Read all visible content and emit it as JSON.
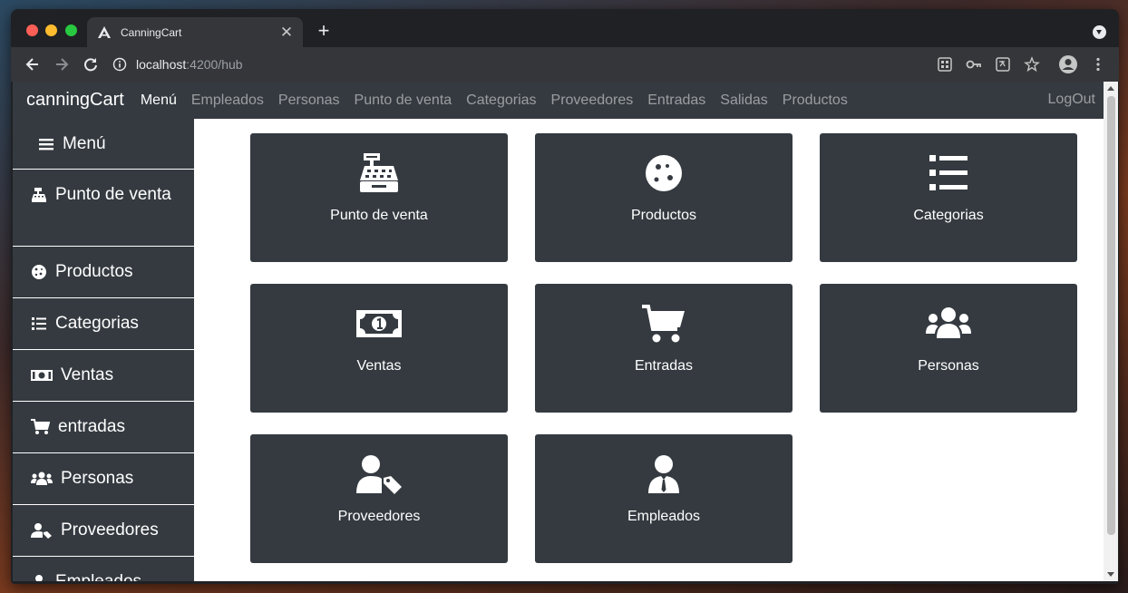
{
  "browser": {
    "tab_title": "CanningCart",
    "url_host": "localhost",
    "url_path": ":4200/hub"
  },
  "navbar": {
    "brand": "canningCart",
    "links": [
      "Menú",
      "Empleados",
      "Personas",
      "Punto de venta",
      "Categorias",
      "Proveedores",
      "Entradas",
      "Salidas",
      "Productos"
    ],
    "logout": "LogOut"
  },
  "sidebar": {
    "items": [
      "Menú",
      "Punto de venta",
      "Productos",
      "Categorias",
      "Ventas",
      "entradas",
      "Personas",
      "Proveedores",
      "Empleados"
    ]
  },
  "tiles": [
    {
      "label": "Punto de venta",
      "icon": "cash-register-icon"
    },
    {
      "label": "Productos",
      "icon": "cookie-icon"
    },
    {
      "label": "Categorias",
      "icon": "list-icon"
    },
    {
      "label": "Ventas",
      "icon": "money-bill-icon"
    },
    {
      "label": "Entradas",
      "icon": "shopping-cart-icon"
    },
    {
      "label": "Personas",
      "icon": "users-icon"
    },
    {
      "label": "Proveedores",
      "icon": "user-tag-icon"
    },
    {
      "label": "Empleados",
      "icon": "user-tie-icon"
    }
  ],
  "colors": {
    "navbar_bg": "#343a40",
    "tile_bg": "#343a40",
    "page_bg": "#ffffff"
  }
}
